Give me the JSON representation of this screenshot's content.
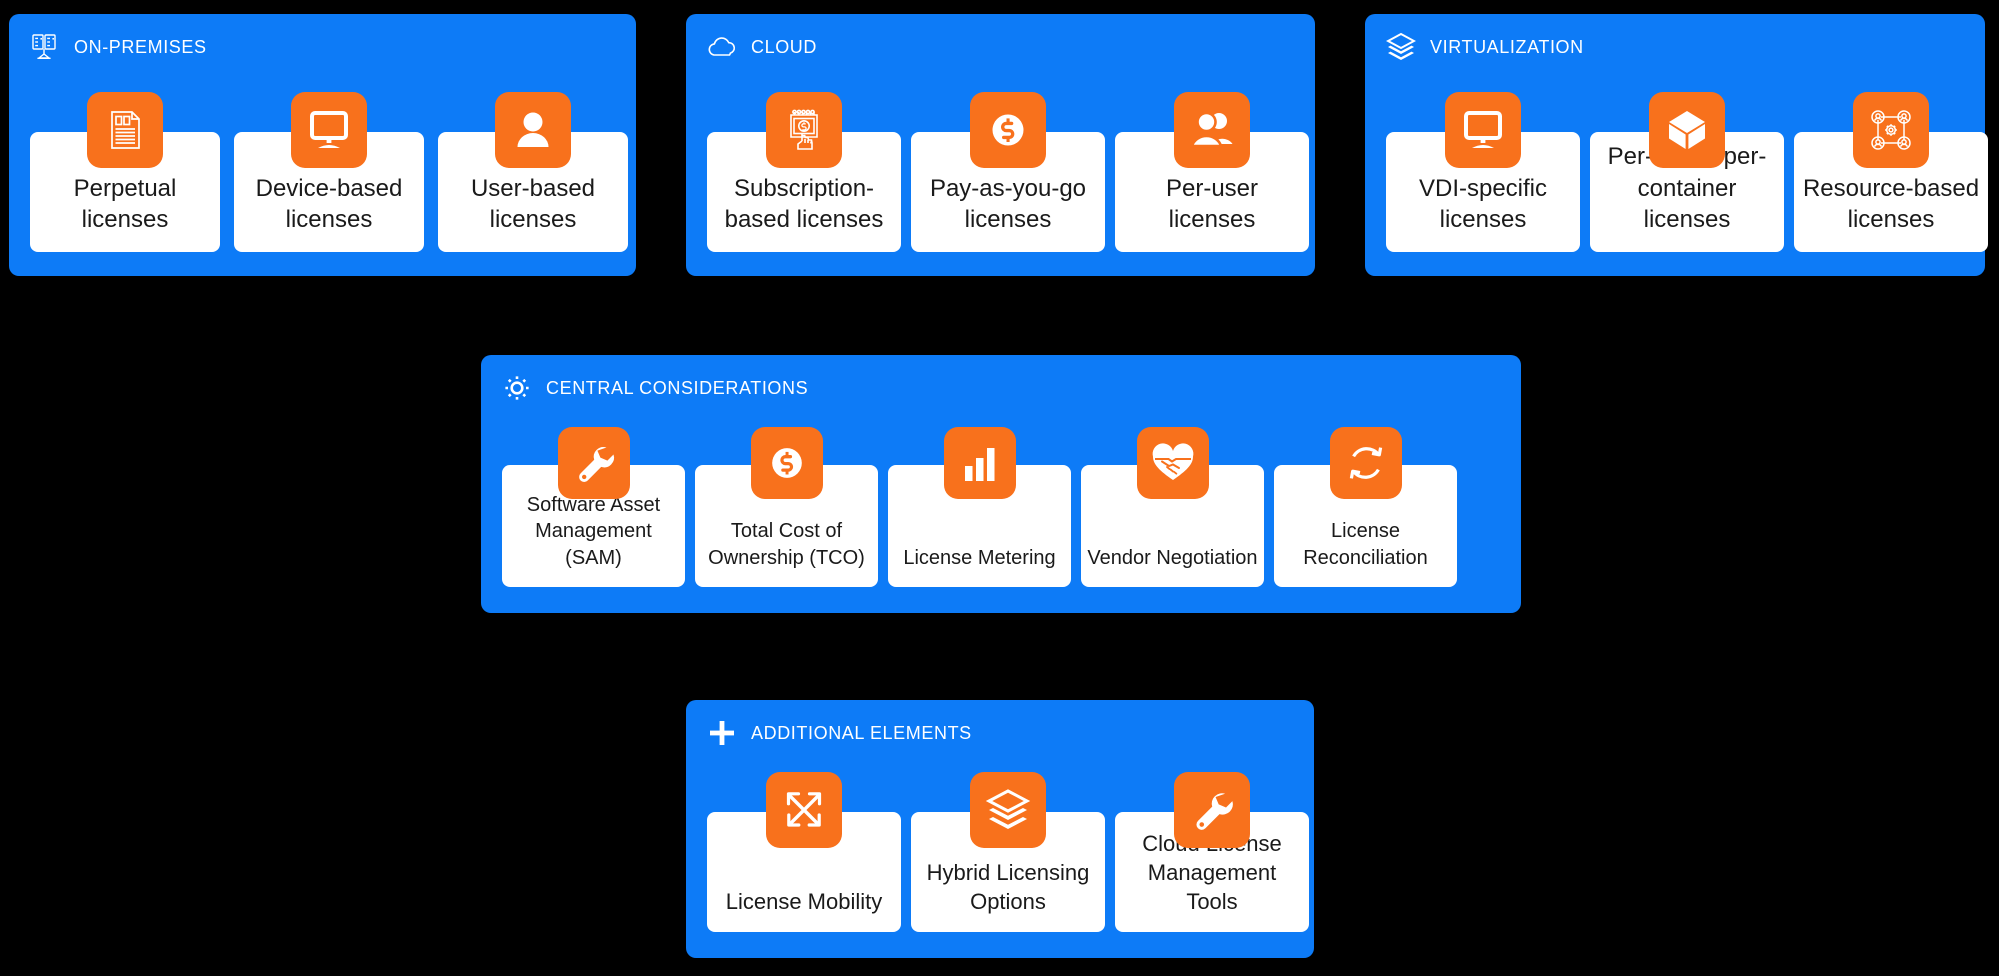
{
  "theme": {
    "background": "#000000",
    "panel_blue": "#0d7bf7",
    "icon_orange": "#f8711c",
    "card_white": "#ffffff",
    "card_text": "#1a1a1a",
    "panel_title_text": "#ffffff"
  },
  "panels": [
    {
      "id": "onprem",
      "title": "ON-PREMISES",
      "icon": "server-rack-icon",
      "cards": [
        {
          "label": "Perpetual licenses",
          "icon": "document-certificate-icon"
        },
        {
          "label": "Device-based licenses",
          "icon": "desktop-monitor-icon"
        },
        {
          "label": "User-based licenses",
          "icon": "single-user-icon"
        }
      ]
    },
    {
      "id": "cloud",
      "title": "CLOUD",
      "icon": "cloud-icon",
      "cards": [
        {
          "label": "Subscription-based licenses",
          "icon": "calendar-payment-hand-icon"
        },
        {
          "label": "Pay-as-you-go licenses",
          "icon": "dollar-coin-icon"
        },
        {
          "label": "Per-user licenses",
          "icon": "two-users-icon"
        }
      ]
    },
    {
      "id": "virt",
      "title": "VIRTUALIZATION",
      "icon": "layers-icon",
      "cards": [
        {
          "label": "VDI-specific licenses",
          "icon": "desktop-monitor-icon"
        },
        {
          "label": "Per-VM or per-container licenses",
          "icon": "cube-box-icon"
        },
        {
          "label": "Resource-based licenses",
          "icon": "network-users-gear-icon"
        }
      ]
    },
    {
      "id": "central",
      "title": "CENTRAL CONSIDERATIONS",
      "icon": "gear-icon",
      "cards": [
        {
          "label": "Software Asset Management (SAM)",
          "icon": "wrench-icon"
        },
        {
          "label": "Total Cost of Ownership (TCO)",
          "icon": "dollar-coin-icon"
        },
        {
          "label": "License Metering",
          "icon": "bar-chart-icon"
        },
        {
          "label": "Vendor Negotiation",
          "icon": "handshake-heart-icon"
        },
        {
          "label": "License Reconciliation",
          "icon": "refresh-cycle-icon"
        }
      ]
    },
    {
      "id": "additional",
      "title": "ADDITIONAL ELEMENTS",
      "icon": "plus-icon",
      "cards": [
        {
          "label": "License Mobility",
          "icon": "crossing-arrows-icon"
        },
        {
          "label": "Hybrid Licensing Options",
          "icon": "layers-icon"
        },
        {
          "label": "Cloud License Management Tools",
          "icon": "wrench-icon"
        }
      ]
    }
  ]
}
